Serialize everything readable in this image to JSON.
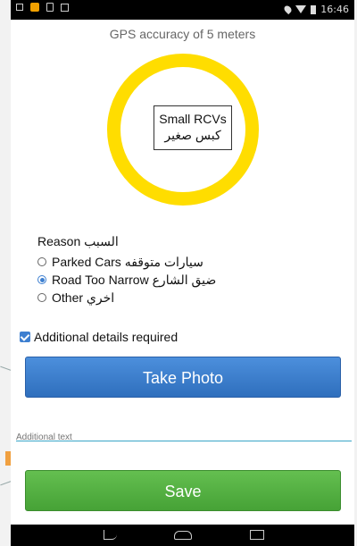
{
  "status_bar": {
    "time": "16:46"
  },
  "gps": {
    "accuracy_text": "GPS accuracy of 5 meters"
  },
  "vehicle": {
    "type_en": "Small RCVs",
    "type_ar": "كبس صغير"
  },
  "reason": {
    "title": "Reason السبب",
    "options": [
      {
        "label": "Parked Cars سيارات متوقفه",
        "selected": false
      },
      {
        "label": "Road Too Narrow ضيق الشارع",
        "selected": true
      },
      {
        "label": "Other اخري",
        "selected": false
      }
    ]
  },
  "details": {
    "label": "Additional details required",
    "checked": true
  },
  "buttons": {
    "take_photo": "Take Photo",
    "save": "Save"
  },
  "additional_text": {
    "placeholder": "Additional text",
    "value": ""
  },
  "colors": {
    "ring": "#ffdd00",
    "photo_button": "#3d7fd0",
    "save_button": "#56b043",
    "accent": "#3d7fd0"
  },
  "icons": {
    "status_left": [
      "image-icon",
      "lock-icon",
      "sd-card-icon",
      "checkbox-icon"
    ],
    "status_right": [
      "location-pin-icon",
      "wifi-icon",
      "battery-icon"
    ],
    "nav": [
      "back-icon",
      "home-icon",
      "recent-apps-icon"
    ]
  }
}
